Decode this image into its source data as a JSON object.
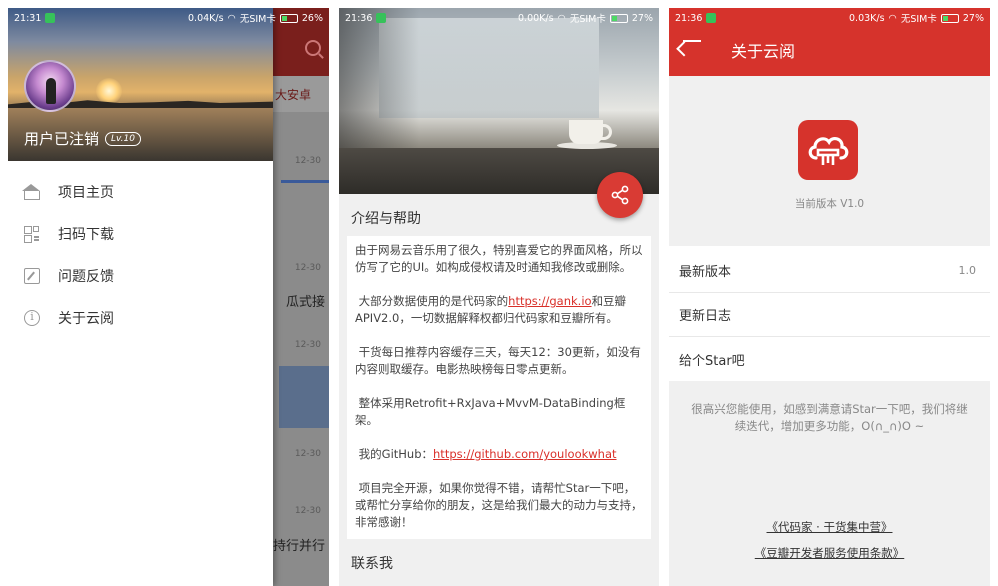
{
  "screen1": {
    "status": {
      "time": "21:31",
      "speed": "0.04K/s",
      "sim": "无SIM卡",
      "battery": "26%"
    },
    "background_tab": "大安卓",
    "background_times": [
      "12-30",
      "12-30",
      "12-30",
      "12-30",
      "12-30"
    ],
    "background_snippets": [
      "瓜式接",
      "持行并行"
    ],
    "drawer": {
      "username": "用户已注销",
      "level": "Lv.10",
      "menu": [
        {
          "label": "项目主页",
          "icon": "home-icon"
        },
        {
          "label": "扫码下载",
          "icon": "qr-code-icon"
        },
        {
          "label": "问题反馈",
          "icon": "edit-icon"
        },
        {
          "label": "关于云阅",
          "icon": "info-icon"
        }
      ]
    }
  },
  "screen2": {
    "status": {
      "time": "21:36",
      "speed": "0.00K/s",
      "sim": "无SIM卡",
      "battery": "27%"
    },
    "section_title": "介绍与帮助",
    "paragraphs": {
      "p1": "由于网易云音乐用了很久，特别喜爱它的界面风格，所以仿写了它的UI。如构成侵权请及时通知我修改或删除。",
      "p2_before": "大部分数据使用的是代码家的",
      "p2_link": "https://gank.io",
      "p2_after": "和豆瓣APIV2.0，一切数据解释权都归代码家和豆瓣所有。",
      "p3": "干货每日推荐内容缓存三天，每天12：30更新，如没有内容则取缓存。电影热映榜每日零点更新。",
      "p4": "整体采用Retrofit+RxJava+MvvM-DataBinding框架。",
      "p5_before": "我的GitHub：",
      "p5_link": "https://github.com/youlookwhat",
      "p6": "项目完全开源，如果你觉得不错，请帮忙Star一下吧，或帮忙分享给你的朋友，这是给我们最大的动力与支持，非常感谢！"
    },
    "contact_title": "联系我",
    "fab_icon": "share-icon"
  },
  "screen3": {
    "status": {
      "time": "21:36",
      "speed": "0.03K/s",
      "sim": "无SIM卡",
      "battery": "27%"
    },
    "title": "关于云阅",
    "version_text": "当前版本 V1.0",
    "rows": [
      {
        "label": "最新版本",
        "value": "1.0"
      },
      {
        "label": "更新日志",
        "value": ""
      },
      {
        "label": "给个Star吧",
        "value": ""
      }
    ],
    "note": "很高兴您能使用，如感到满意请Star一下吧，我们将继续迭代，增加更多功能，O(∩_∩)O ~",
    "links": [
      "《代码家 · 干货集中营》",
      "《豆瓣开发者服务使用条款》"
    ]
  },
  "colors": {
    "accent": "#d6332c",
    "link": "#d9302a"
  }
}
